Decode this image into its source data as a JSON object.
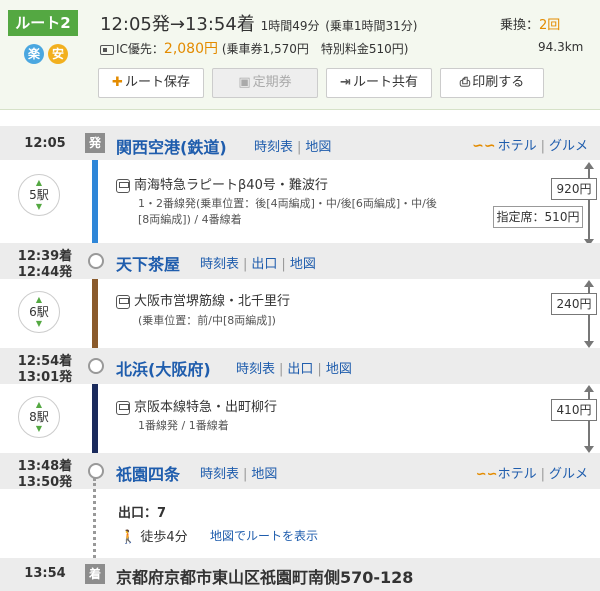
{
  "header": {
    "route_label": "ルート2",
    "tag1": "楽",
    "tag2": "安",
    "time_range": "12:05発→13:54着",
    "duration": "1時間49分",
    "ride_time": "(乗車1時間31分)",
    "transfer_label": "乗換：",
    "transfer_count": "2回",
    "ic_label": "IC優先：",
    "fare": "2,080円",
    "fare_detail": "(乗車券1,570円　特別料金510円)",
    "distance": "94.3km",
    "buttons": {
      "save": "ルート保存",
      "pass": "定期券",
      "share": "ルート共有",
      "print": "印刷する"
    }
  },
  "stations": [
    {
      "time": "12:05",
      "badge": "発",
      "name": "関西空港(鉄道)",
      "links": [
        "時刻表",
        "地図"
      ],
      "extra": [
        "ホテル",
        "グルメ"
      ]
    },
    {
      "time_arr": "12:39着",
      "time_dep": "12:44発",
      "name": "天下茶屋",
      "links": [
        "時刻表",
        "出口",
        "地図"
      ]
    },
    {
      "time_arr": "12:54着",
      "time_dep": "13:01発",
      "name": "北浜(大阪府)",
      "links": [
        "時刻表",
        "出口",
        "地図"
      ]
    },
    {
      "time_arr": "13:48着",
      "time_dep": "13:50発",
      "name": "祇園四条",
      "links": [
        "時刻表",
        "地図"
      ],
      "extra": [
        "ホテル",
        "グルメ"
      ]
    }
  ],
  "segments": [
    {
      "stops": "5駅",
      "train": "南海特急ラピートβ40号・難波行",
      "note1": "1・2番線発(乗車位置：後[4両編成]・中/後[6両編成]・中/後",
      "note2": "[8両編成]) / 4番線着",
      "fare": "920円",
      "reserved": "指定席：510円",
      "color": "#2e86d8"
    },
    {
      "stops": "6駅",
      "train": "大阪市営堺筋線・北千里行",
      "note1": "(乗車位置：前/中[8両編成])",
      "fare": "240円",
      "color": "#8a5a2b"
    },
    {
      "stops": "8駅",
      "train": "京阪本線特急・出町柳行",
      "note1": "1番線発 / 1番線着",
      "fare": "410円",
      "color": "#1a2a5c"
    }
  ],
  "walk": {
    "exit": "出口：7",
    "walk_time": "徒歩4分",
    "map_link": "地図でルートを表示"
  },
  "destination": {
    "time": "13:54",
    "badge": "着",
    "address": "京都府京都市東山区祇園町南側570-128"
  }
}
